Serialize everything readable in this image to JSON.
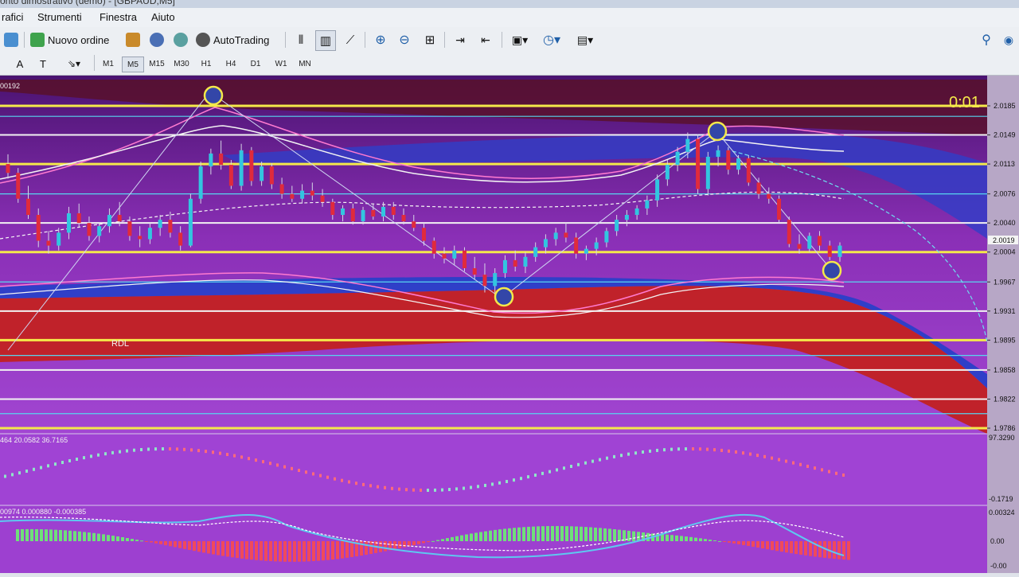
{
  "title": "onto dimostrativo (demo) - [GBPAUD,M5]",
  "menu": {
    "items": [
      "rafici",
      "Strumenti",
      "Finestra",
      "Aiuto"
    ]
  },
  "toolbar": {
    "new_order_label": "Nuovo ordine",
    "autotrading_label": "AutoTrading"
  },
  "timeframes": [
    "M1",
    "M5",
    "M15",
    "M30",
    "H1",
    "H4",
    "D1",
    "W1",
    "MN"
  ],
  "active_timeframe": "M5",
  "chart": {
    "symbol_text": "",
    "top_left_value": "00192",
    "countdown": "0:01",
    "current_price": "2.0019",
    "price_levels": [
      "2.0185",
      "2.0149",
      "2.0113",
      "2.0076",
      "2.0040",
      "2.0004",
      "1.9967",
      "1.9931",
      "1.9895",
      "1.9858",
      "1.9822",
      "1.9786"
    ],
    "rdl_label": "RDL",
    "indicator1_values": "464 20.0582 36.7165",
    "indicator1_scale_top": "97.3290",
    "indicator1_scale_bottom": "-0.1719",
    "indicator2_values": "00974 0.000880 -0.000385",
    "indicator2_scale_top": "0.00324",
    "indicator2_scale_zero": "0.00",
    "indicator2_scale_bottom": "-0.00"
  },
  "colors": {
    "chart_bg": "#7a1f9a",
    "bull": "#32c6e0",
    "bear": "#e02b3c",
    "level": "#f4e94a"
  },
  "candles": [
    [
      2.0113,
      2.0125,
      2.0095,
      2.0102
    ],
    [
      2.0102,
      2.0108,
      2.0065,
      2.007
    ],
    [
      2.007,
      2.0086,
      2.0045,
      2.005
    ],
    [
      2.005,
      2.0058,
      2.001,
      2.0018
    ],
    [
      2.0018,
      2.003,
      2.0002,
      2.0012
    ],
    [
      2.0012,
      2.0034,
      2.0006,
      2.0028
    ],
    [
      2.0028,
      2.006,
      2.002,
      2.0052
    ],
    [
      2.0052,
      2.0064,
      2.0035,
      2.004
    ],
    [
      2.004,
      2.0048,
      2.0018,
      2.0024
    ],
    [
      2.0024,
      2.004,
      2.0016,
      2.0036
    ],
    [
      2.0036,
      2.0058,
      2.0028,
      2.005
    ],
    [
      2.005,
      2.0066,
      2.0036,
      2.0042
    ],
    [
      2.0042,
      2.0048,
      2.0018,
      2.0024
    ],
    [
      2.0024,
      2.0036,
      2.001,
      2.002
    ],
    [
      2.002,
      2.004,
      2.0014,
      2.0034
    ],
    [
      2.0034,
      2.005,
      2.0024,
      2.0044
    ],
    [
      2.0044,
      2.0054,
      2.0022,
      2.0028
    ],
    [
      2.0028,
      2.0036,
      2.0006,
      2.0012
    ],
    [
      2.0012,
      2.0076,
      2.001,
      2.007
    ],
    [
      2.007,
      2.0116,
      2.0064,
      2.011
    ],
    [
      2.011,
      2.0132,
      2.01,
      2.0126
    ],
    [
      2.0126,
      2.0142,
      2.0106,
      2.0112
    ],
    [
      2.0112,
      2.0118,
      2.0082,
      2.0086
    ],
    [
      2.0086,
      2.0138,
      2.008,
      2.013
    ],
    [
      2.013,
      2.0134,
      2.0086,
      2.0092
    ],
    [
      2.0092,
      2.0116,
      2.0086,
      2.011
    ],
    [
      2.011,
      2.0114,
      2.0082,
      2.0088
    ],
    [
      2.0088,
      2.0096,
      2.007,
      2.0076
    ],
    [
      2.0076,
      2.0086,
      2.0066,
      2.007
    ],
    [
      2.007,
      2.0088,
      2.0064,
      2.008
    ],
    [
      2.008,
      2.009,
      2.0068,
      2.0074
    ],
    [
      2.0074,
      2.0082,
      2.006,
      2.0066
    ],
    [
      2.0066,
      2.007,
      2.0044,
      2.005
    ],
    [
      2.005,
      2.0062,
      2.0042,
      2.0058
    ],
    [
      2.0058,
      2.0064,
      2.0038,
      2.0042
    ],
    [
      2.0042,
      2.006,
      2.0038,
      2.0056
    ],
    [
      2.0056,
      2.0064,
      2.0044,
      2.0048
    ],
    [
      2.0048,
      2.0066,
      2.0042,
      2.006
    ],
    [
      2.006,
      2.0066,
      2.0044,
      2.005
    ],
    [
      2.005,
      2.0058,
      2.0038,
      2.0042
    ],
    [
      2.0042,
      2.005,
      2.003,
      2.0034
    ],
    [
      2.0034,
      2.004,
      2.0012,
      2.0018
    ],
    [
      2.0018,
      2.0022,
      1.9996,
      2.0002
    ],
    [
      2.0002,
      2.001,
      1.999,
      1.9996
    ],
    [
      1.9996,
      2.0012,
      1.9988,
      2.0006
    ],
    [
      2.0006,
      2.001,
      1.998,
      1.9984
    ],
    [
      1.9984,
      1.9998,
      1.997,
      1.9976
    ],
    [
      1.9976,
      1.999,
      1.9954,
      1.9962
    ],
    [
      1.9962,
      1.9984,
      1.995,
      1.9978
    ],
    [
      1.9978,
      2.0,
      1.9972,
      1.9994
    ],
    [
      1.9994,
      2.0006,
      1.998,
      1.9986
    ],
    [
      1.9986,
      2.0004,
      1.9978,
      1.9998
    ],
    [
      1.9998,
      2.0016,
      1.9992,
      2.001
    ],
    [
      2.001,
      2.0026,
      2.0002,
      2.002
    ],
    [
      2.002,
      2.0034,
      2.0012,
      2.0028
    ],
    [
      2.0028,
      2.004,
      2.0016,
      2.0022
    ],
    [
      2.0022,
      2.0028,
      1.9996,
      2.0002
    ],
    [
      2.0002,
      2.0012,
      1.9994,
      2.0008
    ],
    [
      2.0008,
      2.0022,
      2.0,
      2.0016
    ],
    [
      2.0016,
      2.0034,
      2.001,
      2.003
    ],
    [
      2.003,
      2.005,
      2.0024,
      2.0044
    ],
    [
      2.0044,
      2.0056,
      2.0036,
      2.005
    ],
    [
      2.005,
      2.0062,
      2.0044,
      2.0058
    ],
    [
      2.0058,
      2.0074,
      2.005,
      2.0068
    ],
    [
      2.0068,
      2.01,
      2.006,
      2.0094
    ],
    [
      2.0094,
      2.0118,
      2.0086,
      2.0112
    ],
    [
      2.0112,
      2.0134,
      2.0104,
      2.0128
    ],
    [
      2.0128,
      2.0152,
      2.012,
      2.0144
    ],
    [
      2.0144,
      2.015,
      2.0076,
      2.0082
    ],
    [
      2.0082,
      2.0128,
      2.0074,
      2.0122
    ],
    [
      2.0122,
      2.0136,
      2.011,
      2.013
    ],
    [
      2.013,
      2.0134,
      2.01,
      2.0106
    ],
    [
      2.0106,
      2.0124,
      2.01,
      2.012
    ],
    [
      2.012,
      2.0124,
      2.0086,
      2.009
    ],
    [
      2.009,
      2.0096,
      2.007,
      2.0076
    ],
    [
      2.0076,
      2.0084,
      2.0064,
      2.007
    ],
    [
      2.007,
      2.0074,
      2.004,
      2.0044
    ],
    [
      2.0044,
      2.0048,
      2.001,
      2.0014
    ],
    [
      2.0014,
      2.0026,
      2.0002,
      2.0008
    ],
    [
      2.0008,
      2.0028,
      2.0004,
      2.0024
    ],
    [
      2.0024,
      2.003,
      2.0006,
      2.0012
    ],
    [
      2.0012,
      2.0018,
      1.9994,
      1.9998
    ],
    [
      1.9998,
      2.0016,
      1.9992,
      2.0012
    ]
  ],
  "level_lines": [
    2.0185,
    2.0113,
    2.0004,
    1.9895,
    1.9786
  ],
  "white_levels": [
    2.0149,
    2.004,
    1.9931,
    1.9858,
    1.9822
  ],
  "cyan_levels": [
    2.0172,
    2.0076,
    1.9967,
    1.9876,
    1.9804
  ]
}
